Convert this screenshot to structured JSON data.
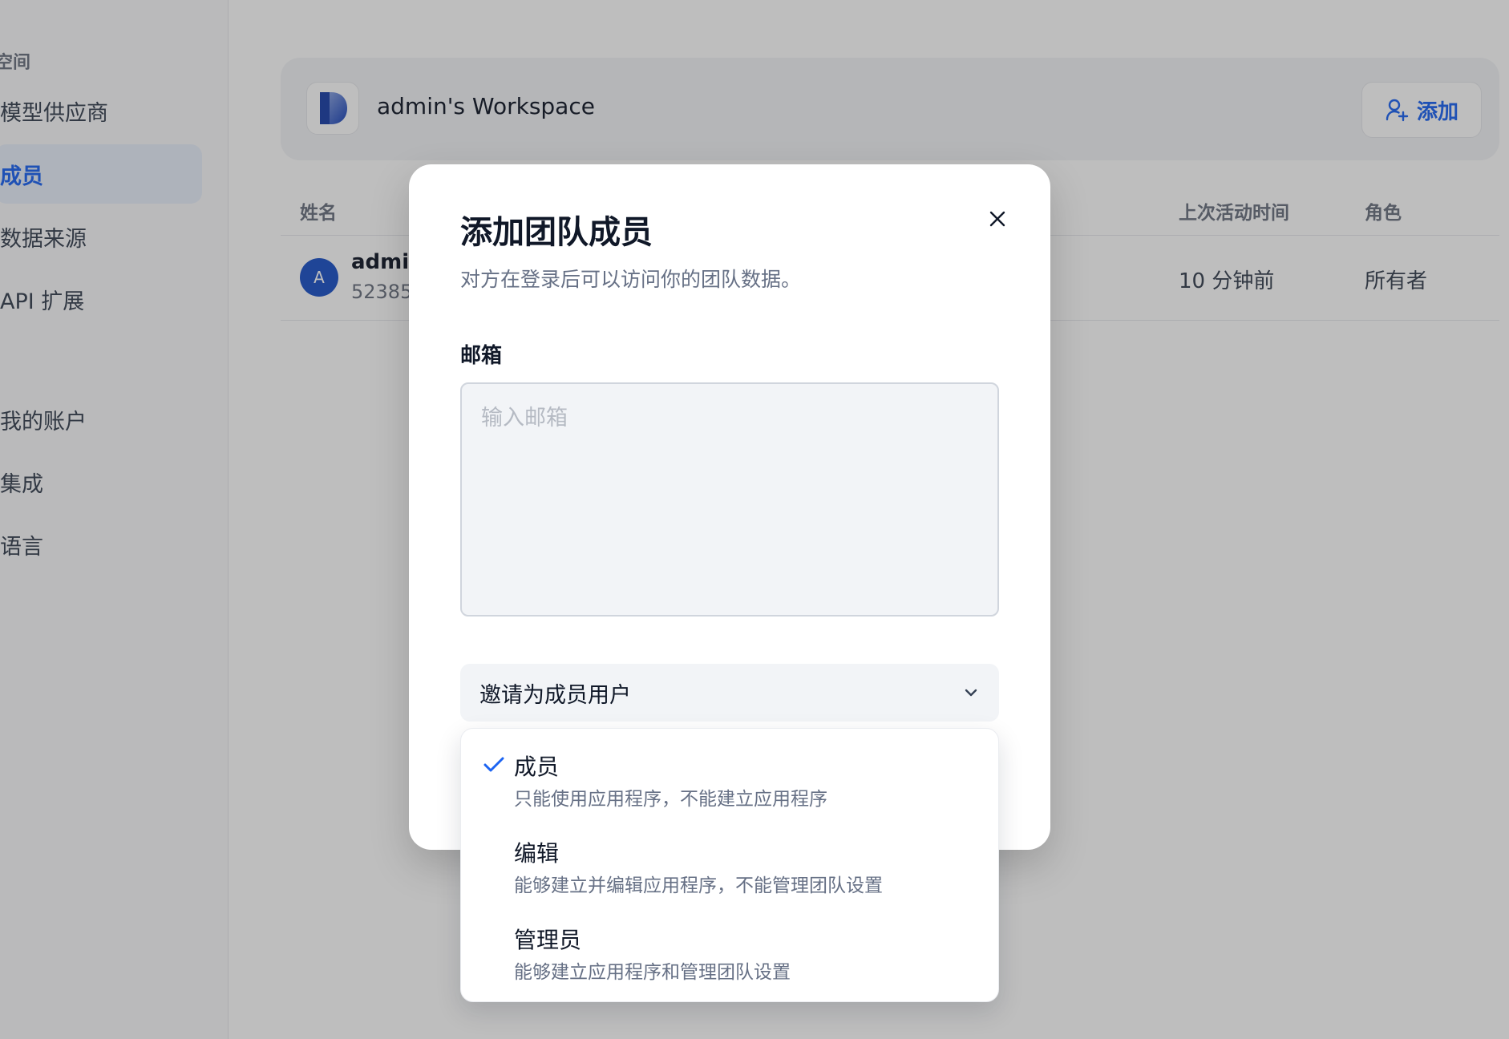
{
  "sidebar": {
    "section_heading": "空间",
    "items": [
      {
        "label": "模型供应商"
      },
      {
        "label": "成员"
      },
      {
        "label": "数据来源"
      },
      {
        "label": "API 扩展"
      },
      {
        "label": "我的账户"
      },
      {
        "label": "集成"
      },
      {
        "label": "语言"
      }
    ]
  },
  "workspace": {
    "name": "admin's Workspace",
    "add_label": "添加"
  },
  "table": {
    "headers": [
      "姓名",
      "上次活动时间",
      "角色"
    ],
    "rows": [
      {
        "avatar_initial": "A",
        "name": "admin",
        "email": "52385",
        "last_active": "10 分钟前",
        "role": "所有者"
      }
    ]
  },
  "modal": {
    "title": "添加团队成员",
    "subtitle": "对方在登录后可以访问你的团队数据。",
    "email_label": "邮箱",
    "email_placeholder": "输入邮箱",
    "email_value": "",
    "role_selected": "邀请为成员用户",
    "role_options": [
      {
        "title": "成员",
        "description": "只能使用应用程序，不能建立应用程序",
        "selected": true
      },
      {
        "title": "编辑",
        "description": "能够建立并编辑应用程序，不能管理团队设置",
        "selected": false
      },
      {
        "title": "管理员",
        "description": "能够建立应用程序和管理团队设置",
        "selected": false
      }
    ]
  },
  "icons": {
    "close": "close-icon",
    "chevron": "chevron-down-icon",
    "check": "check-icon",
    "add_user": "user-plus-icon",
    "workspace_logo": "workspace-logo-icon"
  },
  "colors": {
    "accent": "#1c64f2",
    "avatar": "#1c52c8",
    "overlay": "rgba(40,40,40,0.3)"
  }
}
